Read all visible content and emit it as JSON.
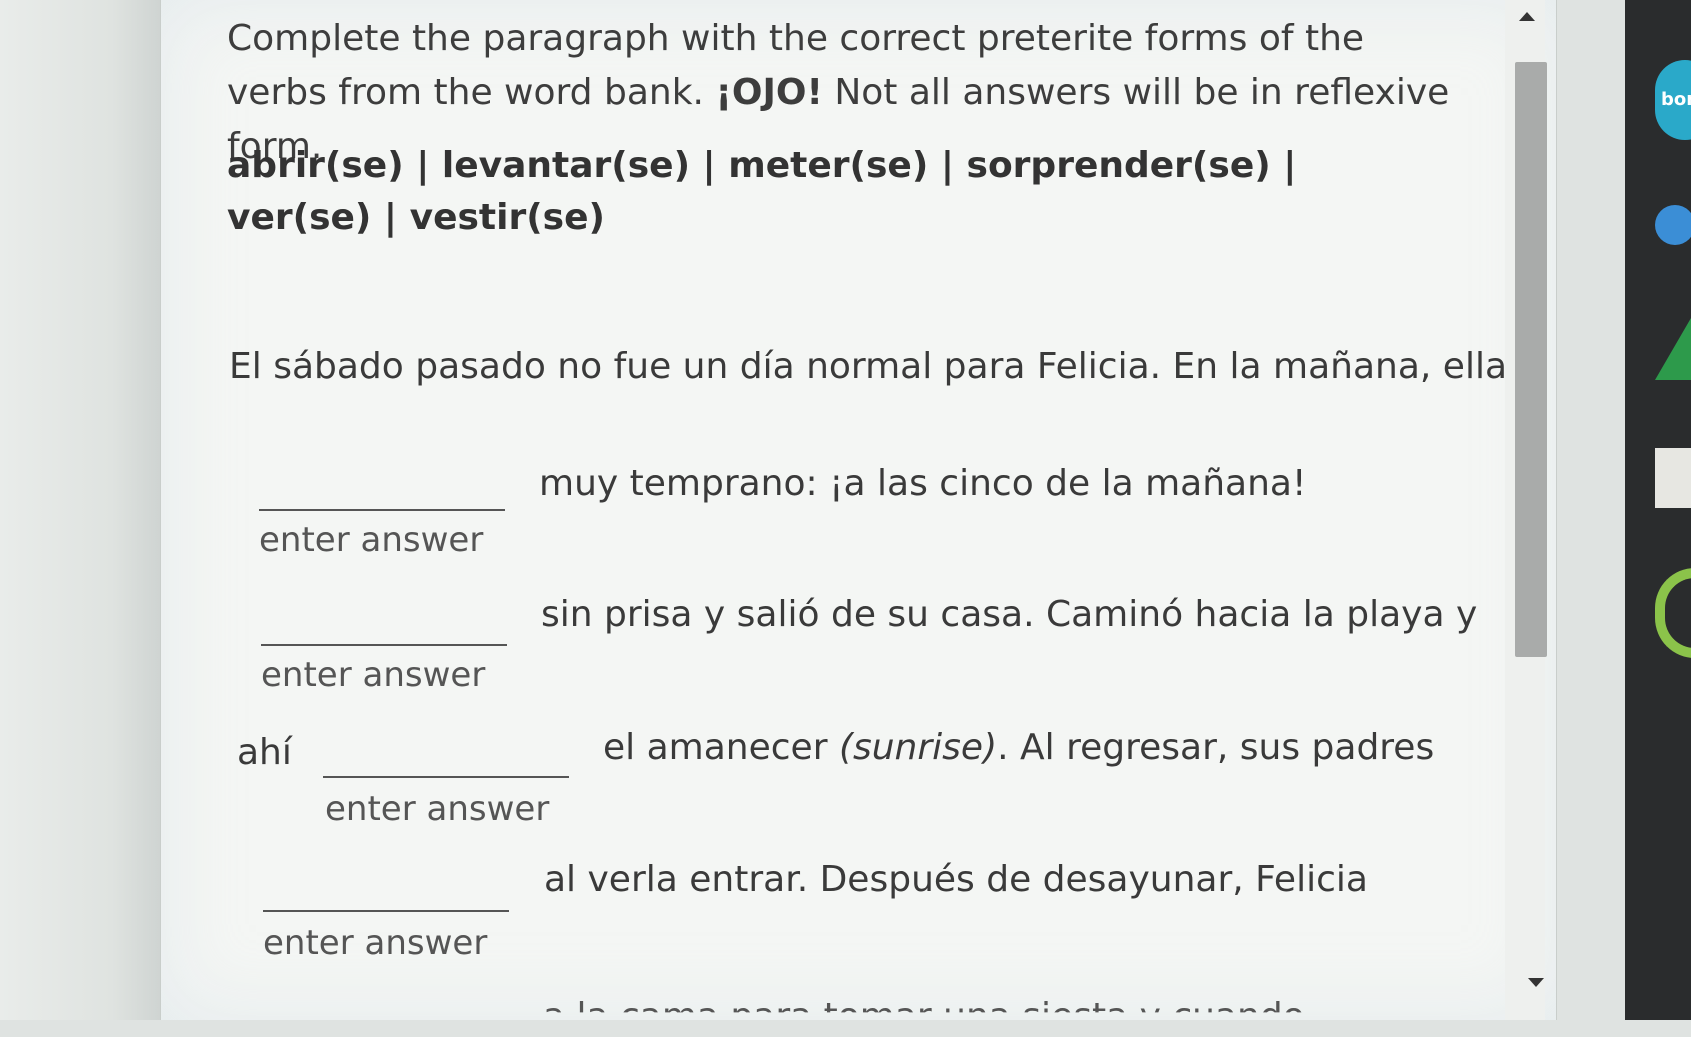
{
  "instructions": {
    "text_before": "Complete the paragraph with the correct preterite forms of the verbs from the word bank. ",
    "ojo": "¡OJO!",
    "text_after": " Not all answers will be in reflexive form."
  },
  "word_bank": "abrir(se) | levantar(se) | meter(se) | sorprender(se) | ver(se) | vestir(se)",
  "paragraph": {
    "intro": "El sábado pasado no fue un día normal para Felicia. En la mañana, ella",
    "after_blank1": "muy temprano: ¡a las cinco de la mañana!",
    "after_blank2": "sin prisa y salió de su casa. Caminó hacia la playa y",
    "before_blank3": "ahí",
    "after_blank3_a": "el amanecer ",
    "after_blank3_sunrise": "(sunrise)",
    "after_blank3_b": ". Al regresar, sus padres",
    "after_blank4": "al verla entrar. Después de desayunar, Felicia",
    "cut_off": "a la cama para tomar una siesta y cuando"
  },
  "answer_placeholder": "enter answer",
  "dock": {
    "app_label": "bon"
  }
}
